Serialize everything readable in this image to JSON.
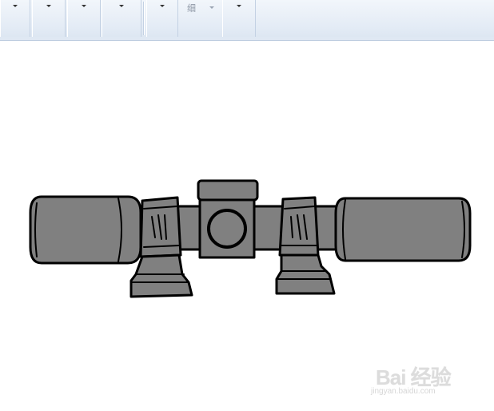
{
  "toolbar": {
    "buttons": [
      {
        "name": "dropdown-1"
      },
      {
        "name": "dropdown-2"
      },
      {
        "name": "dropdown-3"
      },
      {
        "name": "dropdown-4"
      },
      {
        "name": "dropdown-5"
      },
      {
        "name": "size-dropdown",
        "label": "细"
      },
      {
        "name": "dropdown-7"
      }
    ]
  },
  "canvas": {
    "drawing": "rifle-scope",
    "fill_color": "#808080",
    "stroke_color": "#000000"
  },
  "watermark": {
    "top": "Bai 经验",
    "bottom": "jingyan.baidu.com"
  }
}
